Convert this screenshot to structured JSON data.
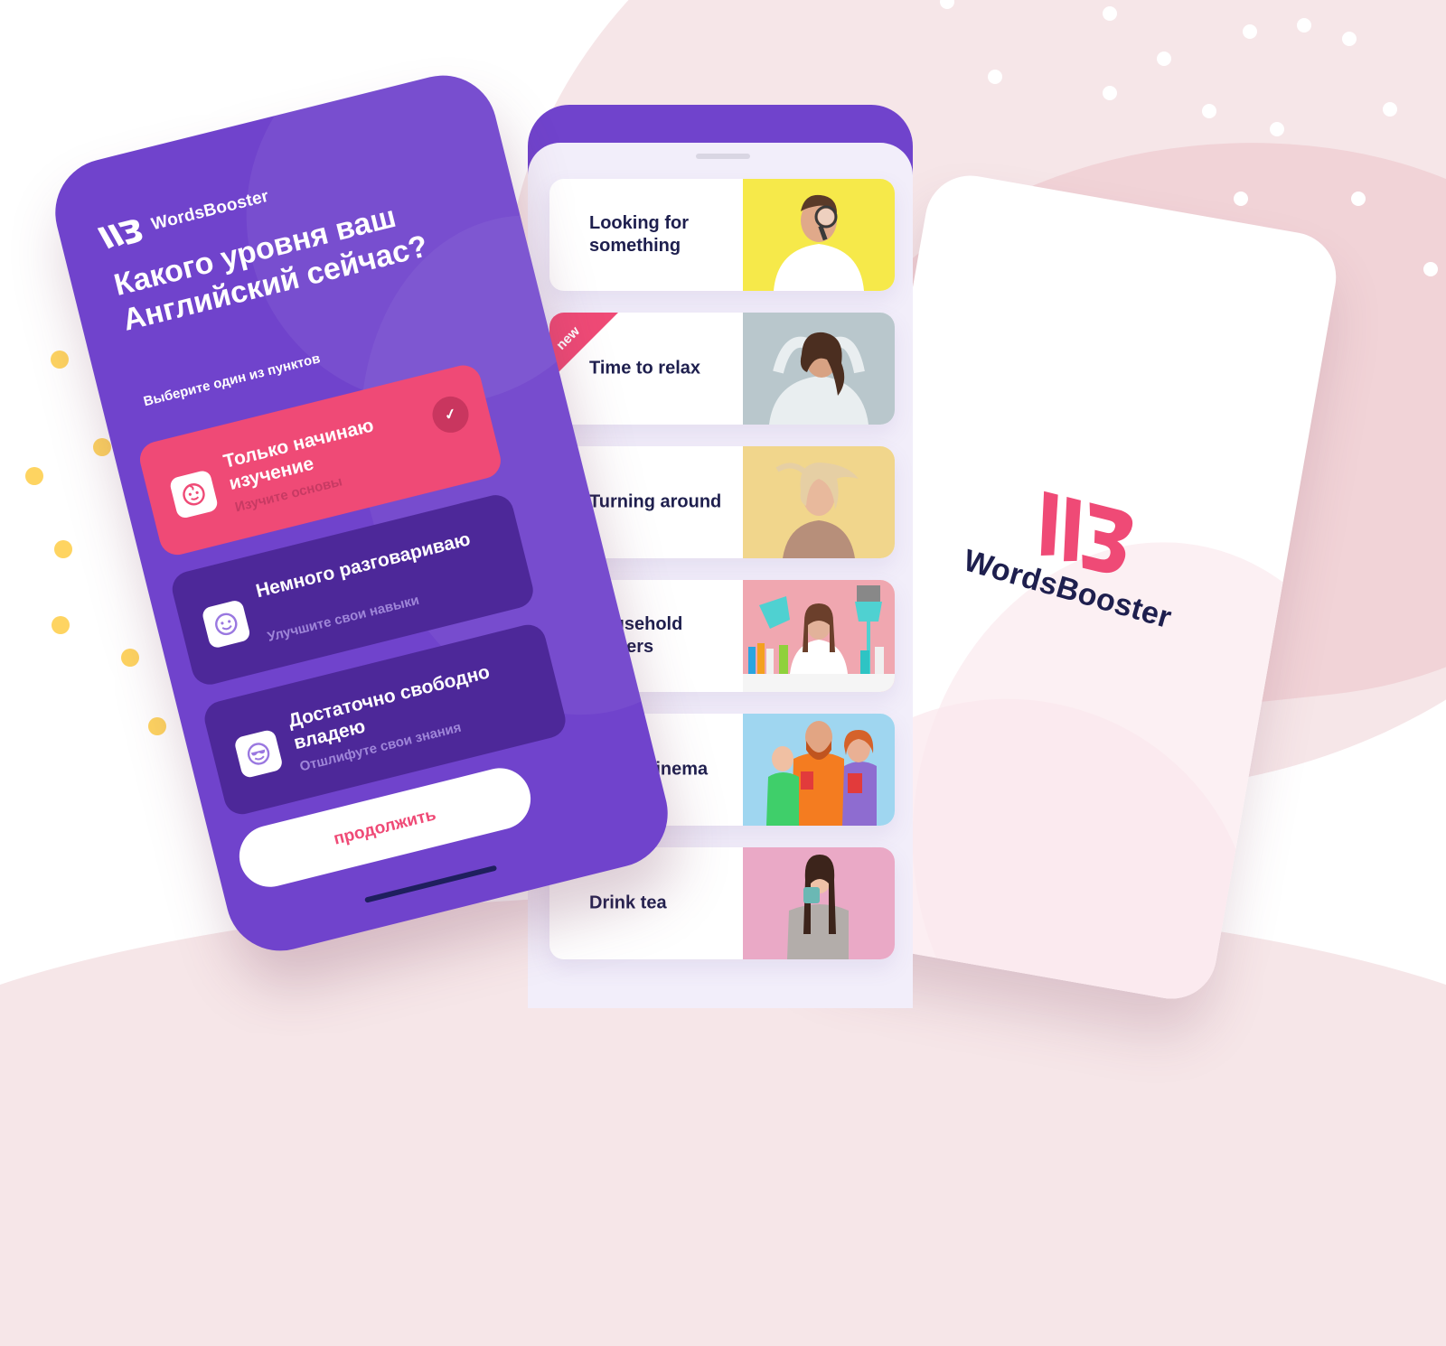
{
  "brand": {
    "name": "WordsBooster",
    "colors": {
      "primary_purple": "#7043cc",
      "option_dark": "#4d2899",
      "accent_pink": "#ef4a76",
      "text_dark": "#1e1f4e",
      "sheet_bg": "#f2eefa",
      "bg_pink": "#f6e6e8",
      "dot_yellow": "#fed461"
    }
  },
  "level_screen": {
    "logo_text": "WordsBooster",
    "question": "Какого уровня ваш Английский сейчас?",
    "hint": "Выберите один из пунктов",
    "options": [
      {
        "title": "Только начинаю изучение",
        "subtitle": "Изучите основы",
        "icon": "baby-face-icon",
        "selected": true
      },
      {
        "title": "Немного разговариваю",
        "subtitle": "Улучшите свои навыки",
        "icon": "smile-face-icon",
        "selected": false
      },
      {
        "title": "Достаточно свободно владею",
        "subtitle": "Отшлифуте свои знания",
        "icon": "sunglasses-face-icon",
        "selected": false
      }
    ],
    "continue_label": "продолжить"
  },
  "lessons_screen": {
    "lessons": [
      {
        "title": "Looking for something",
        "photo": "man-with-magnifier",
        "photo_bg": "#f6e94a",
        "badge": ""
      },
      {
        "title": "Time to relax",
        "photo": "woman-relaxing",
        "photo_bg": "#b9c7cc",
        "badge": "new"
      },
      {
        "title": "Turning around",
        "photo": "woman-hair-flip",
        "photo_bg": "#f1d68c",
        "badge": ""
      },
      {
        "title": "Household helpers",
        "photo": "woman-with-cleaning-tools",
        "photo_bg": "#f0a7b0",
        "badge": ""
      },
      {
        "title": "At the cinema",
        "photo": "family-with-popcorn",
        "photo_bg": "#9fd6f0",
        "badge": ""
      },
      {
        "title": "Drink tea",
        "photo": "woman-drinking-tea",
        "photo_bg": "#eaa9c6",
        "badge": ""
      }
    ]
  },
  "splash_screen": {
    "logo_text": "WordsBooster"
  }
}
